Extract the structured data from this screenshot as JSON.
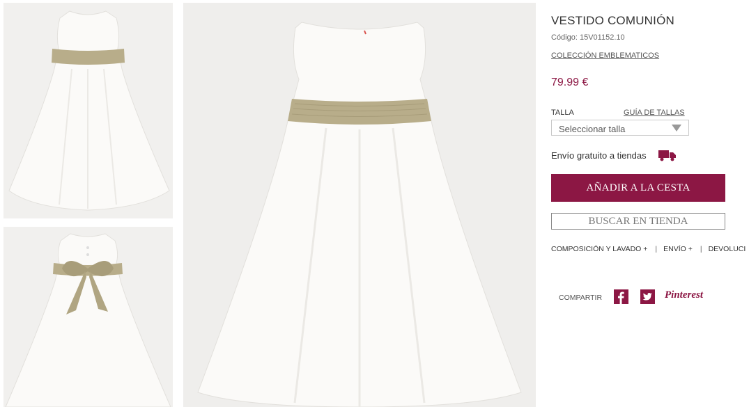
{
  "gallery": {
    "images": [
      {
        "name": "thumbnail-front"
      },
      {
        "name": "thumbnail-back"
      },
      {
        "name": "main-image-front"
      }
    ]
  },
  "product": {
    "title": "VESTIDO COMUNIÓN",
    "code": "Código: 15V01152.10",
    "collection": "COLECCIÓN EMBLEMATICOS",
    "price": "79.99 €"
  },
  "size": {
    "label": "TALLA",
    "guide_link": "GUÍA DE TALLAS",
    "select_value": "Seleccionar talla"
  },
  "shipping": {
    "text": "Envío gratuito a tiendas",
    "icon": "truck-icon"
  },
  "buttons": {
    "add_to_cart": "AÑADIR A LA CESTA",
    "find_in_store": "BUSCAR EN TIENDA"
  },
  "info_tabs": {
    "items": [
      "COMPOSICIÓN Y LAVADO +",
      "ENVÍO +",
      "DEVOLUCI"
    ],
    "separator": "|"
  },
  "share": {
    "label": "COMPARTIR",
    "facebook_icon": "facebook-icon",
    "twitter_icon": "twitter-icon",
    "pinterest": "Pinterest"
  },
  "colors": {
    "accent": "#8c1744",
    "sash": "#b8ad8a",
    "dress": "#fbfaf8",
    "photo_bg": "#efeeec"
  }
}
